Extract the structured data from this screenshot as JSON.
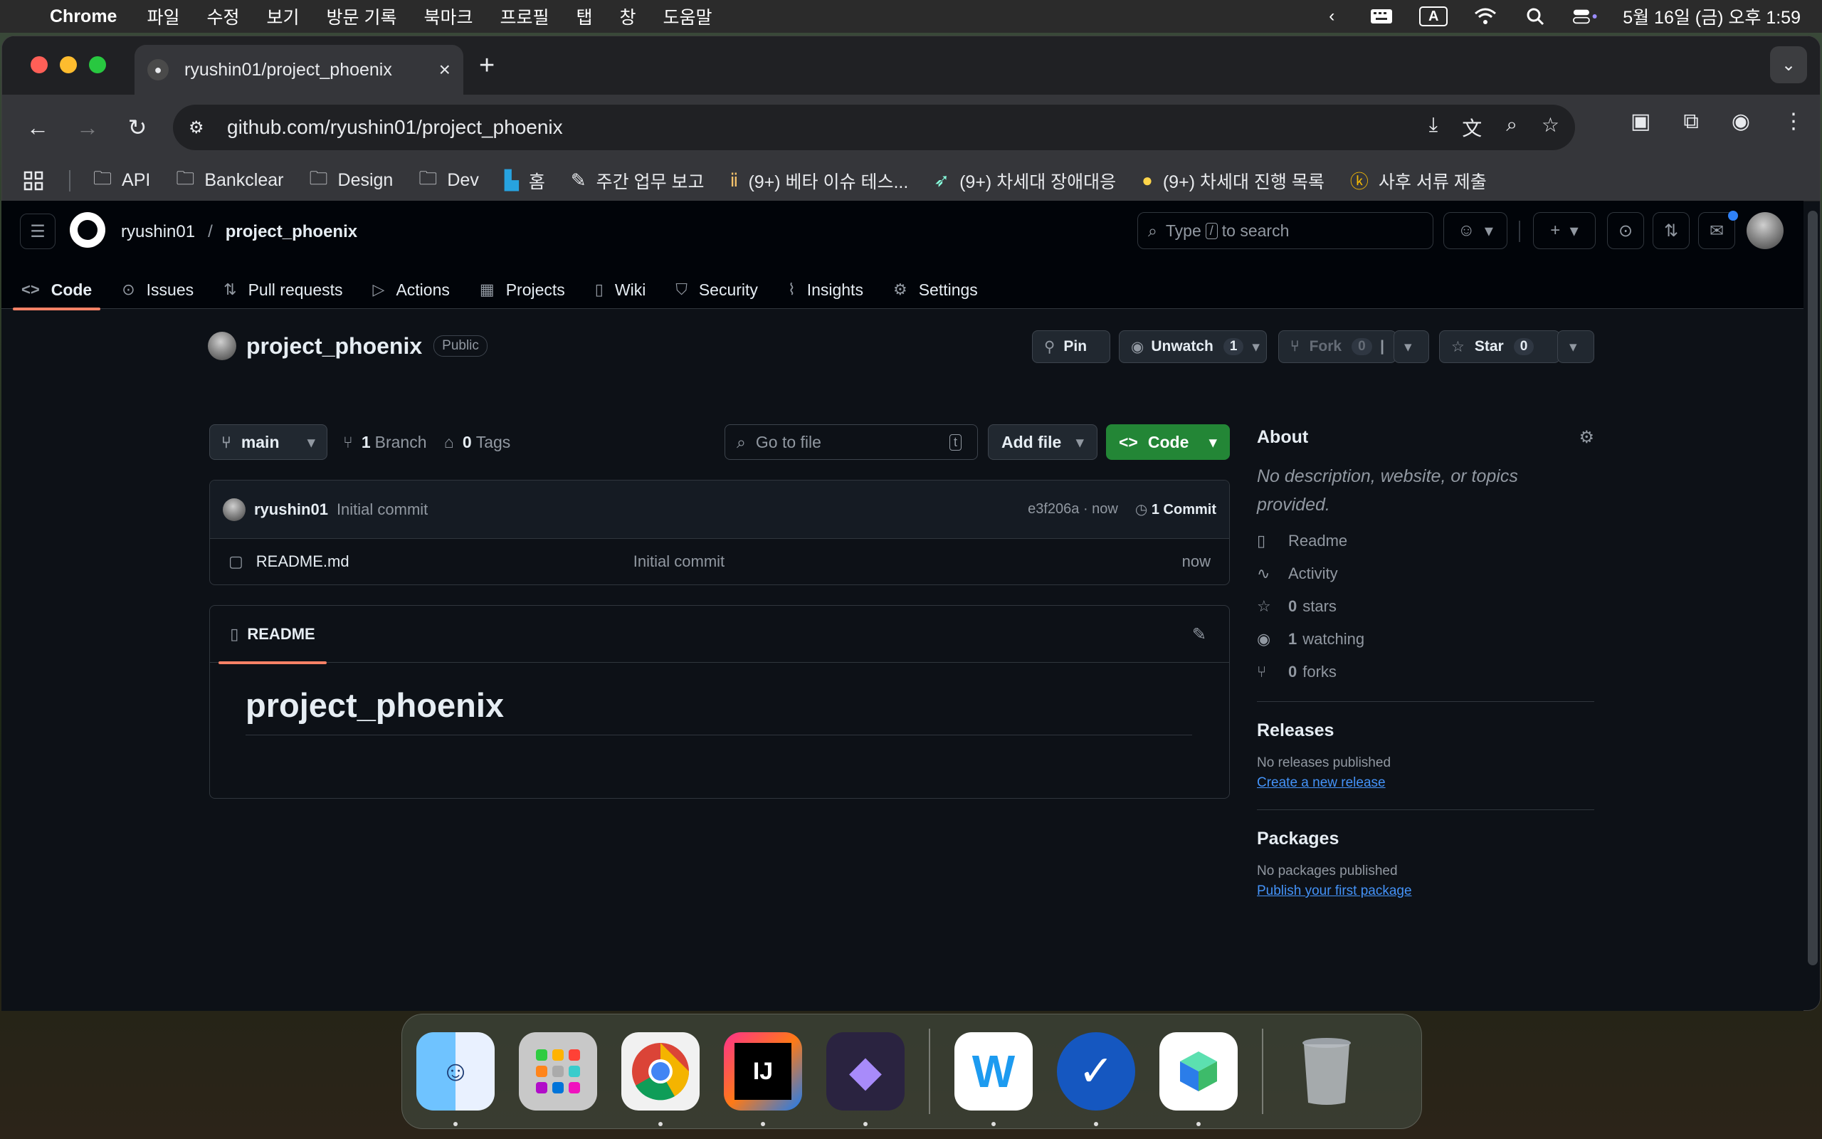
{
  "menubar": {
    "apple": "",
    "app": "Chrome",
    "menus": [
      "파일",
      "수정",
      "보기",
      "방문 기록",
      "북마크",
      "프로필",
      "탭",
      "창",
      "도움말"
    ],
    "input_indicator": "A",
    "datetime": "5월 16일 (금) 오후 1:59"
  },
  "browser": {
    "tab_title": "ryushin01/project_phoenix",
    "url": "github.com/ryushin01/project_phoenix",
    "bookmarks": [
      {
        "icon": "folder-icon",
        "label": "API"
      },
      {
        "icon": "folder-icon",
        "label": "Bankclear"
      },
      {
        "icon": "folder-icon",
        "label": "Design"
      },
      {
        "icon": "folder-icon",
        "label": "Dev"
      },
      {
        "icon": "home-app-icon",
        "label": "홈"
      },
      {
        "icon": "memo-icon",
        "label": "주간 업무 보고"
      },
      {
        "icon": "pray-icon",
        "label": "(9+) 베타 이슈 테스..."
      },
      {
        "icon": "feather-icon",
        "label": "(9+) 차세대 장애대응"
      },
      {
        "icon": "bulb-icon",
        "label": "(9+) 차세대 진행 목록"
      },
      {
        "icon": "k-icon",
        "label": "사후 서류 제출"
      }
    ]
  },
  "github": {
    "owner": "ryushin01",
    "repo": "project_phoenix",
    "search_prefix": "Type",
    "search_key": "/",
    "search_suffix": "to search",
    "nav": [
      {
        "label": "Code",
        "icon": "code-icon"
      },
      {
        "label": "Issues",
        "icon": "issue-icon"
      },
      {
        "label": "Pull requests",
        "icon": "pull-request-icon"
      },
      {
        "label": "Actions",
        "icon": "play-icon"
      },
      {
        "label": "Projects",
        "icon": "table-icon"
      },
      {
        "label": "Wiki",
        "icon": "book-icon"
      },
      {
        "label": "Security",
        "icon": "shield-icon"
      },
      {
        "label": "Insights",
        "icon": "graph-icon"
      },
      {
        "label": "Settings",
        "icon": "gear-icon"
      }
    ],
    "visibility": "Public",
    "actions": {
      "pin": "Pin",
      "unwatch": "Unwatch",
      "watch_count": "1",
      "fork": "Fork",
      "fork_count": "0",
      "star": "Star",
      "star_count": "0"
    },
    "branch": "main",
    "branch_count": "1",
    "branch_label": "Branch",
    "tag_count": "0",
    "tag_label": "Tags",
    "goto_file": "Go to file",
    "goto_key": "t",
    "add_file": "Add file",
    "code_button": "Code",
    "commit": {
      "author": "ryushin01",
      "message": "Initial commit",
      "hash_time": "e3f206a · now",
      "commits": "1 Commit"
    },
    "files": [
      {
        "name": "README.md",
        "message": "Initial commit",
        "time": "now"
      }
    ],
    "readme_tab": "README",
    "readme_heading": "project_phoenix",
    "about": {
      "title": "About",
      "description": "No description, website, or topics provided.",
      "readme": "Readme",
      "activity": "Activity",
      "stars_n": "0",
      "stars": "stars",
      "watching_n": "1",
      "watching": "watching",
      "forks_n": "0",
      "forks": "forks"
    },
    "releases": {
      "title": "Releases",
      "empty": "No releases published",
      "link": "Create a new release"
    },
    "packages": {
      "title": "Packages",
      "empty": "No packages published",
      "link": "Publish your first package"
    }
  },
  "dock": [
    {
      "name": "finder",
      "label": ""
    },
    {
      "name": "launchpad",
      "label": ""
    },
    {
      "name": "chrome",
      "label": ""
    },
    {
      "name": "intellij",
      "label": "IJ"
    },
    {
      "name": "obsidian",
      "label": ""
    },
    {
      "name": "naver-works",
      "label": "W"
    },
    {
      "name": "task-app",
      "label": ""
    },
    {
      "name": "naver-box",
      "label": ""
    },
    {
      "name": "trash",
      "label": ""
    }
  ]
}
